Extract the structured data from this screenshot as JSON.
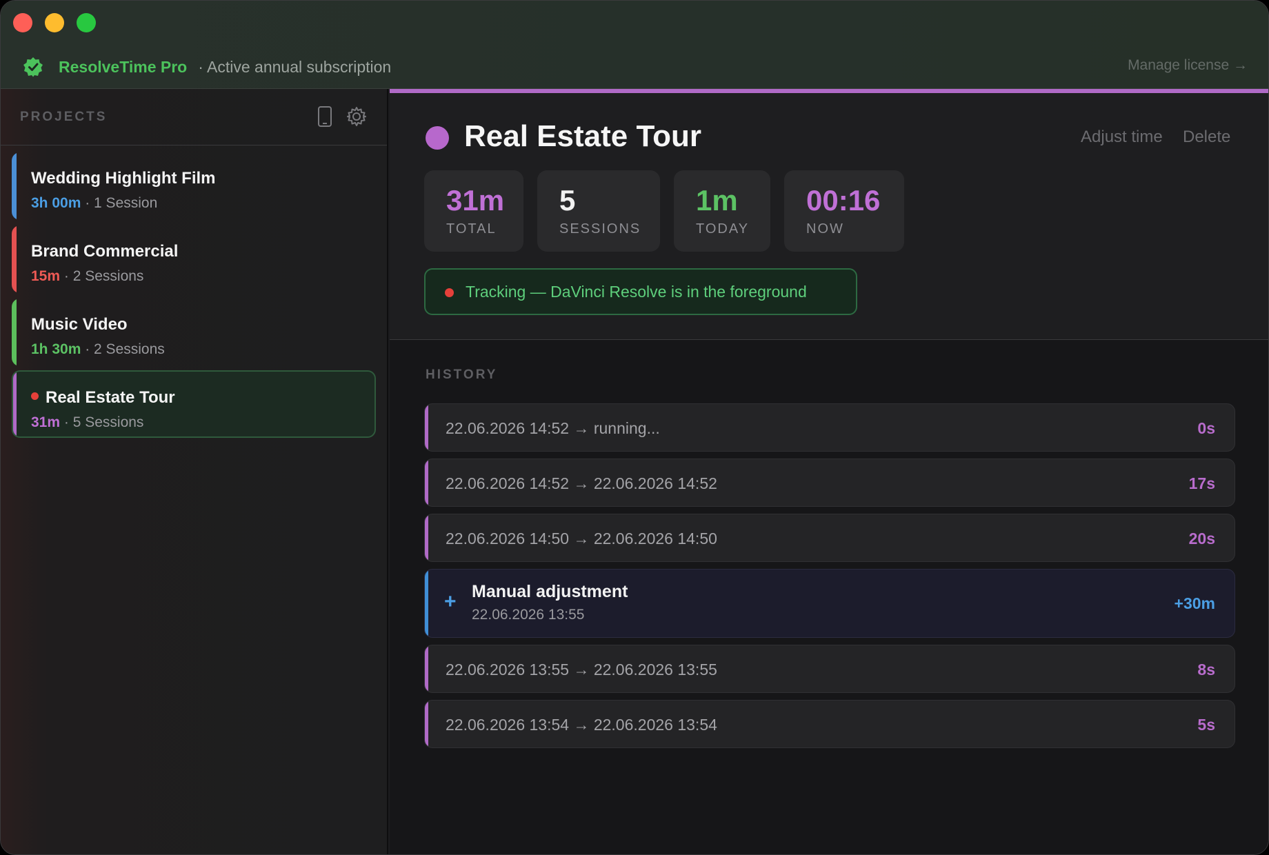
{
  "titlebar": {
    "app_name": "ResolveTime Pro",
    "subscription": "· Active annual subscription",
    "manage_link": "Manage license →"
  },
  "sidebar": {
    "title": "PROJECTS",
    "projects": [
      {
        "name": "Wedding Highlight Film",
        "time": "3h 00m",
        "sessions": "· 1 Session",
        "color": "#4b8fd6",
        "active": false
      },
      {
        "name": "Brand Commercial",
        "time": "15m",
        "sessions": "· 2 Sessions",
        "color": "#e55151",
        "active": false
      },
      {
        "name": "Music Video",
        "time": "1h 30m",
        "sessions": "· 2 Sessions",
        "color": "#5cbf5c",
        "active": false
      },
      {
        "name": "Real Estate Tour",
        "time": "31m",
        "sessions": "· 5 Sessions",
        "color": "#b06ac7",
        "active": true
      }
    ]
  },
  "project": {
    "title": "Real Estate Tour",
    "color": "#b768cc",
    "adjust_time": "Adjust time",
    "delete": "Delete",
    "stats": [
      {
        "value": "31m",
        "label": "TOTAL",
        "color": "#c070d6"
      },
      {
        "value": "5",
        "label": "SESSIONS",
        "color": "#f2f2f2"
      },
      {
        "value": "1m",
        "label": "TODAY",
        "color": "#5cc264"
      },
      {
        "value": "00:16",
        "label": "NOW",
        "color": "#c070d6"
      }
    ],
    "tracking_status": "Tracking — DaVinci Resolve is in the foreground"
  },
  "history": {
    "title": "HISTORY",
    "rows": [
      {
        "range": "22.06.2026 14:52 → running...",
        "duration": "0s"
      },
      {
        "range": "22.06.2026 14:52 → 22.06.2026 14:52",
        "duration": "17s"
      },
      {
        "range": "22.06.2026 14:50 → 22.06.2026 14:50",
        "duration": "20s"
      },
      {
        "range": "22.06.2026 13:55 → 22.06.2026 13:55",
        "duration": "8s"
      },
      {
        "range": "22.06.2026 13:54 → 22.06.2026 13:54",
        "duration": "5s"
      }
    ],
    "manual": {
      "icon": "+",
      "title": "Manual adjustment",
      "date": "22.06.2026 13:55",
      "amount": "+30m"
    }
  }
}
